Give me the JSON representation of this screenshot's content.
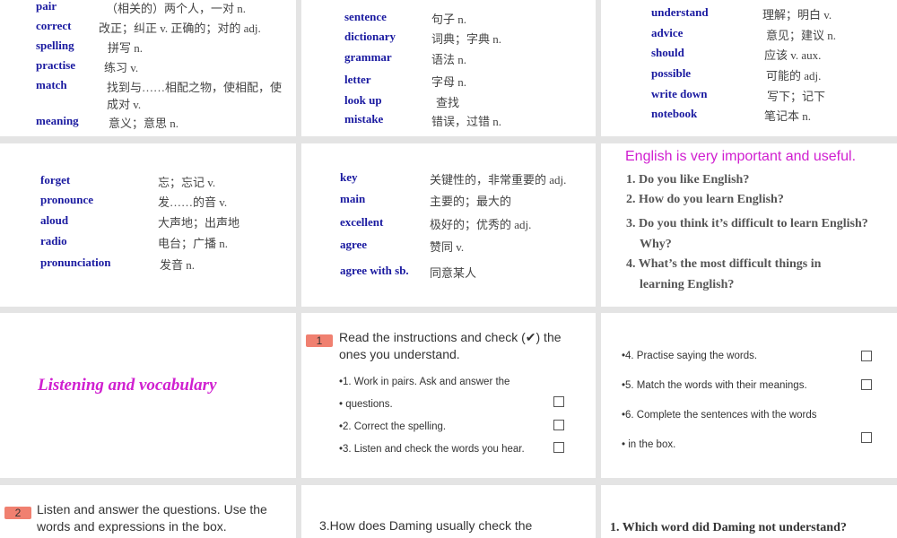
{
  "slides": [
    {
      "words": [
        [
          "pair",
          "（相关的）两个人，一对  n."
        ],
        [
          "correct",
          "改正；纠正  v. 正确的；对的   adj."
        ],
        [
          "spelling",
          "拼写  n."
        ],
        [
          "practise",
          "练习  v."
        ],
        [
          "match",
          "找到与……相配之物，使相配，使成对  v."
        ],
        [
          "meaning",
          "意义；意思  n."
        ]
      ]
    },
    {
      "words": [
        [
          "sentence",
          "句子  n."
        ],
        [
          "dictionary",
          "词典；字典  n."
        ],
        [
          "grammar",
          "语法  n."
        ],
        [
          "letter",
          "字母  n."
        ],
        [
          "look up",
          "查找"
        ],
        [
          "mistake",
          "错误，过错  n."
        ]
      ]
    },
    {
      "words": [
        [
          "understand",
          "理解；明白  v."
        ],
        [
          "advice",
          "意见；建议  n."
        ],
        [
          "should",
          "应该  v. aux."
        ],
        [
          "possible",
          "可能的  adj."
        ],
        [
          "write down",
          "写下；记下"
        ],
        [
          "notebook",
          "笔记本  n."
        ]
      ]
    },
    {
      "words": [
        [
          "forget",
          "忘；忘记  v."
        ],
        [
          "pronounce",
          "发……的音  v."
        ],
        [
          "aloud",
          "大声地；出声地"
        ],
        [
          "radio",
          "电台；广播  n."
        ],
        [
          "pronunciation",
          "发音  n."
        ]
      ]
    },
    {
      "words": [
        [
          "key",
          "关键性的，非常重要的  adj."
        ],
        [
          "main",
          "主要的；最大的"
        ],
        [
          "excellent",
          "极好的；优秀的  adj."
        ],
        [
          "agree",
          "赞同  v."
        ],
        [
          "agree with sb.",
          "同意某人"
        ]
      ]
    },
    {
      "title": "English is very important and useful.",
      "questions": [
        "1. Do you like English?",
        "2. How do you learn English?",
        "3. Do you think it’s difficult to learn English?",
        "Why?",
        "4. What’s the most difficult things in",
        "learning English?"
      ]
    },
    {
      "title": "Listening and vocabulary"
    },
    {
      "badge": "1",
      "heading": "Read the instructions and check (✔)  the ones you understand.",
      "items": [
        "•1. Work in pairs. Ask and answer the",
        "•   questions.",
        "•2. Correct the spelling.",
        "•3. Listen and check the words you hear."
      ]
    },
    {
      "items": [
        "•4. Practise saying the words.",
        "•5. Match the words with their meanings.",
        "•6. Complete the sentences with the words",
        "•   in the box."
      ]
    },
    {
      "badge": "2",
      "heading": "Listen and answer the questions. Use the words and expressions in the box."
    },
    {
      "text": "3.How does Daming usually check the"
    },
    {
      "text": "1. Which word did Daming not understand?"
    }
  ]
}
